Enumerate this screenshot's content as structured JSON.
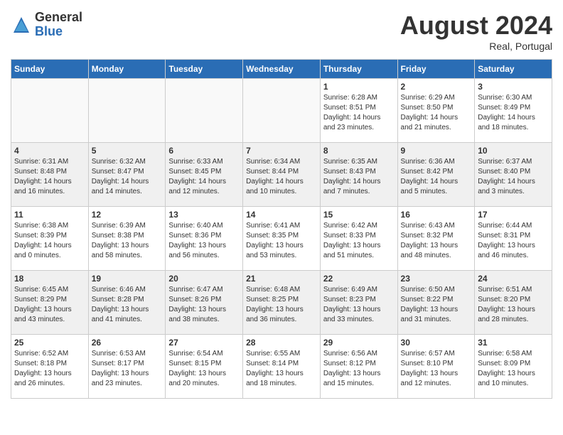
{
  "logo": {
    "general": "General",
    "blue": "Blue"
  },
  "title": "August 2024",
  "location": "Real, Portugal",
  "days_of_week": [
    "Sunday",
    "Monday",
    "Tuesday",
    "Wednesday",
    "Thursday",
    "Friday",
    "Saturday"
  ],
  "weeks": [
    [
      {
        "day": "",
        "info": ""
      },
      {
        "day": "",
        "info": ""
      },
      {
        "day": "",
        "info": ""
      },
      {
        "day": "",
        "info": ""
      },
      {
        "day": "1",
        "info": "Sunrise: 6:28 AM\nSunset: 8:51 PM\nDaylight: 14 hours\nand 23 minutes."
      },
      {
        "day": "2",
        "info": "Sunrise: 6:29 AM\nSunset: 8:50 PM\nDaylight: 14 hours\nand 21 minutes."
      },
      {
        "day": "3",
        "info": "Sunrise: 6:30 AM\nSunset: 8:49 PM\nDaylight: 14 hours\nand 18 minutes."
      }
    ],
    [
      {
        "day": "4",
        "info": "Sunrise: 6:31 AM\nSunset: 8:48 PM\nDaylight: 14 hours\nand 16 minutes."
      },
      {
        "day": "5",
        "info": "Sunrise: 6:32 AM\nSunset: 8:47 PM\nDaylight: 14 hours\nand 14 minutes."
      },
      {
        "day": "6",
        "info": "Sunrise: 6:33 AM\nSunset: 8:45 PM\nDaylight: 14 hours\nand 12 minutes."
      },
      {
        "day": "7",
        "info": "Sunrise: 6:34 AM\nSunset: 8:44 PM\nDaylight: 14 hours\nand 10 minutes."
      },
      {
        "day": "8",
        "info": "Sunrise: 6:35 AM\nSunset: 8:43 PM\nDaylight: 14 hours\nand 7 minutes."
      },
      {
        "day": "9",
        "info": "Sunrise: 6:36 AM\nSunset: 8:42 PM\nDaylight: 14 hours\nand 5 minutes."
      },
      {
        "day": "10",
        "info": "Sunrise: 6:37 AM\nSunset: 8:40 PM\nDaylight: 14 hours\nand 3 minutes."
      }
    ],
    [
      {
        "day": "11",
        "info": "Sunrise: 6:38 AM\nSunset: 8:39 PM\nDaylight: 14 hours\nand 0 minutes."
      },
      {
        "day": "12",
        "info": "Sunrise: 6:39 AM\nSunset: 8:38 PM\nDaylight: 13 hours\nand 58 minutes."
      },
      {
        "day": "13",
        "info": "Sunrise: 6:40 AM\nSunset: 8:36 PM\nDaylight: 13 hours\nand 56 minutes."
      },
      {
        "day": "14",
        "info": "Sunrise: 6:41 AM\nSunset: 8:35 PM\nDaylight: 13 hours\nand 53 minutes."
      },
      {
        "day": "15",
        "info": "Sunrise: 6:42 AM\nSunset: 8:33 PM\nDaylight: 13 hours\nand 51 minutes."
      },
      {
        "day": "16",
        "info": "Sunrise: 6:43 AM\nSunset: 8:32 PM\nDaylight: 13 hours\nand 48 minutes."
      },
      {
        "day": "17",
        "info": "Sunrise: 6:44 AM\nSunset: 8:31 PM\nDaylight: 13 hours\nand 46 minutes."
      }
    ],
    [
      {
        "day": "18",
        "info": "Sunrise: 6:45 AM\nSunset: 8:29 PM\nDaylight: 13 hours\nand 43 minutes."
      },
      {
        "day": "19",
        "info": "Sunrise: 6:46 AM\nSunset: 8:28 PM\nDaylight: 13 hours\nand 41 minutes."
      },
      {
        "day": "20",
        "info": "Sunrise: 6:47 AM\nSunset: 8:26 PM\nDaylight: 13 hours\nand 38 minutes."
      },
      {
        "day": "21",
        "info": "Sunrise: 6:48 AM\nSunset: 8:25 PM\nDaylight: 13 hours\nand 36 minutes."
      },
      {
        "day": "22",
        "info": "Sunrise: 6:49 AM\nSunset: 8:23 PM\nDaylight: 13 hours\nand 33 minutes."
      },
      {
        "day": "23",
        "info": "Sunrise: 6:50 AM\nSunset: 8:22 PM\nDaylight: 13 hours\nand 31 minutes."
      },
      {
        "day": "24",
        "info": "Sunrise: 6:51 AM\nSunset: 8:20 PM\nDaylight: 13 hours\nand 28 minutes."
      }
    ],
    [
      {
        "day": "25",
        "info": "Sunrise: 6:52 AM\nSunset: 8:18 PM\nDaylight: 13 hours\nand 26 minutes."
      },
      {
        "day": "26",
        "info": "Sunrise: 6:53 AM\nSunset: 8:17 PM\nDaylight: 13 hours\nand 23 minutes."
      },
      {
        "day": "27",
        "info": "Sunrise: 6:54 AM\nSunset: 8:15 PM\nDaylight: 13 hours\nand 20 minutes."
      },
      {
        "day": "28",
        "info": "Sunrise: 6:55 AM\nSunset: 8:14 PM\nDaylight: 13 hours\nand 18 minutes."
      },
      {
        "day": "29",
        "info": "Sunrise: 6:56 AM\nSunset: 8:12 PM\nDaylight: 13 hours\nand 15 minutes."
      },
      {
        "day": "30",
        "info": "Sunrise: 6:57 AM\nSunset: 8:10 PM\nDaylight: 13 hours\nand 12 minutes."
      },
      {
        "day": "31",
        "info": "Sunrise: 6:58 AM\nSunset: 8:09 PM\nDaylight: 13 hours\nand 10 minutes."
      }
    ]
  ]
}
